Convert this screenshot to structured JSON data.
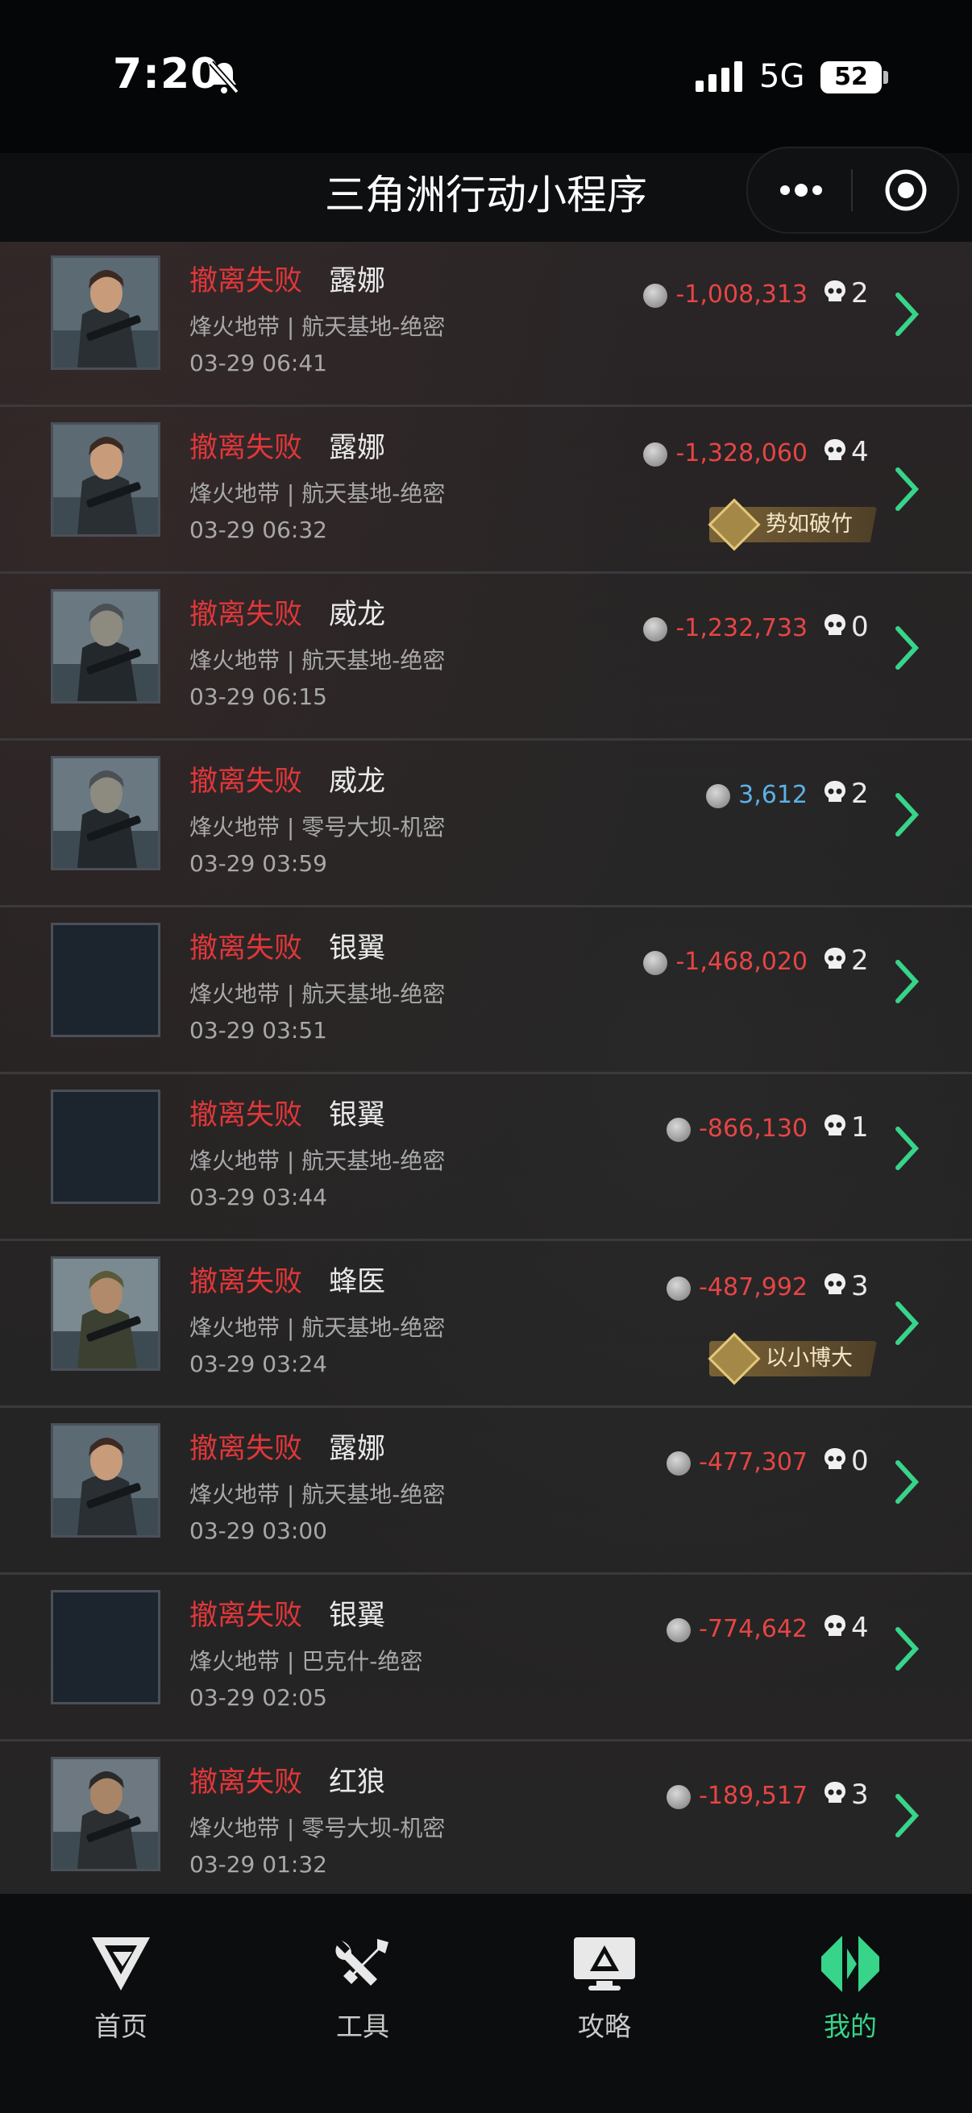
{
  "status_bar": {
    "time": "7:20",
    "network": "5G",
    "battery": "52"
  },
  "header": {
    "title": "三角洲行动小程序"
  },
  "records": [
    {
      "status": "撤离失败",
      "operator": "露娜",
      "map": "烽火地带 | 航天基地-绝密",
      "date": "03-29 06:41",
      "value": "-1,008,313",
      "kills": "2",
      "badge": "",
      "avatar": "luna"
    },
    {
      "status": "撤离失败",
      "operator": "露娜",
      "map": "烽火地带 | 航天基地-绝密",
      "date": "03-29 06:32",
      "value": "-1,328,060",
      "kills": "4",
      "badge": "势如破竹",
      "avatar": "luna"
    },
    {
      "status": "撤离失败",
      "operator": "威龙",
      "map": "烽火地带 | 航天基地-绝密",
      "date": "03-29 06:15",
      "value": "-1,232,733",
      "kills": "0",
      "badge": "",
      "avatar": "weilong"
    },
    {
      "status": "撤离失败",
      "operator": "威龙",
      "map": "烽火地带 | 零号大坝-机密",
      "date": "03-29 03:59",
      "value": "3,612",
      "kills": "2",
      "badge": "",
      "avatar": "weilong"
    },
    {
      "status": "撤离失败",
      "operator": "银翼",
      "map": "烽火地带 | 航天基地-绝密",
      "date": "03-29 03:51",
      "value": "-1,468,020",
      "kills": "2",
      "badge": "",
      "avatar": "blank"
    },
    {
      "status": "撤离失败",
      "operator": "银翼",
      "map": "烽火地带 | 航天基地-绝密",
      "date": "03-29 03:44",
      "value": "-866,130",
      "kills": "1",
      "badge": "",
      "avatar": "blank"
    },
    {
      "status": "撤离失败",
      "operator": "蜂医",
      "map": "烽火地带 | 航天基地-绝密",
      "date": "03-29 03:24",
      "value": "-487,992",
      "kills": "3",
      "badge": "以小博大",
      "avatar": "fengyi"
    },
    {
      "status": "撤离失败",
      "operator": "露娜",
      "map": "烽火地带 | 航天基地-绝密",
      "date": "03-29 03:00",
      "value": "-477,307",
      "kills": "0",
      "badge": "",
      "avatar": "luna"
    },
    {
      "status": "撤离失败",
      "operator": "银翼",
      "map": "烽火地带 | 巴克什-绝密",
      "date": "03-29 02:05",
      "value": "-774,642",
      "kills": "4",
      "badge": "",
      "avatar": "blank"
    },
    {
      "status": "撤离失败",
      "operator": "红狼",
      "map": "烽火地带 | 零号大坝-机密",
      "date": "03-29 01:32",
      "value": "-189,517",
      "kills": "3",
      "badge": "",
      "avatar": "honglang"
    }
  ],
  "tabs": [
    {
      "label": "首页",
      "icon": "home-logo-icon"
    },
    {
      "label": "工具",
      "icon": "tools-icon"
    },
    {
      "label": "攻略",
      "icon": "guide-monitor-icon"
    },
    {
      "label": "我的",
      "icon": "profile-logo-icon",
      "active": true
    }
  ],
  "colors": {
    "fail": "#e0373a",
    "negative": "#e64545",
    "positive": "#5ab2e6",
    "accent": "#37d48a"
  }
}
